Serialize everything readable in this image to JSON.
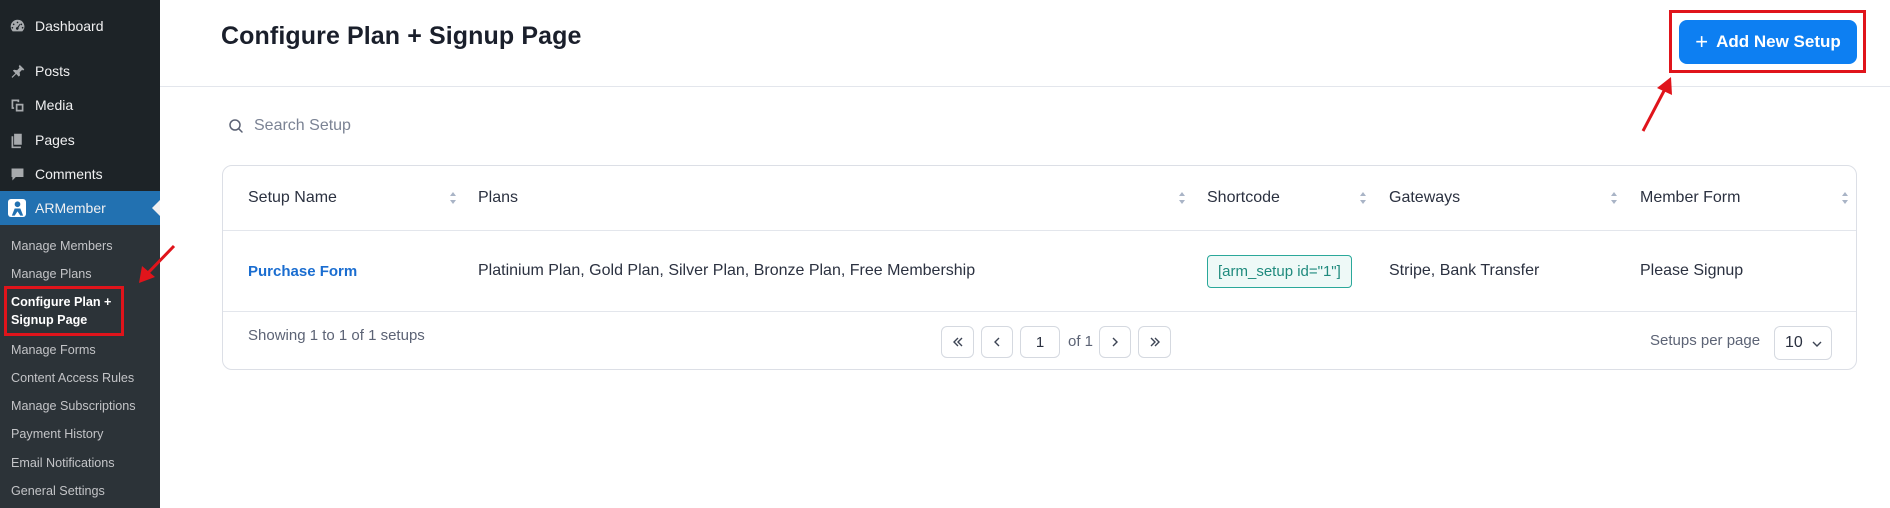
{
  "sidebar": {
    "top_items": [
      {
        "label": "Dashboard",
        "icon": "dashboard-icon"
      },
      {
        "label": "Posts",
        "icon": "pushpin-icon"
      },
      {
        "label": "Media",
        "icon": "media-icon"
      },
      {
        "label": "Pages",
        "icon": "pages-icon"
      },
      {
        "label": "Comments",
        "icon": "comment-icon"
      },
      {
        "label": "ARMember",
        "icon": "armember-logo-icon"
      }
    ],
    "sub_items": [
      "Manage Members",
      "Manage Plans",
      "Configure Plan + Signup Page",
      "Manage Forms",
      "Content Access Rules",
      "Manage Subscriptions",
      "Payment History",
      "Email Notifications",
      "General Settings"
    ],
    "current_line1": "Configure Plan +",
    "current_line2": "Signup Page"
  },
  "header": {
    "title": "Configure Plan + Signup Page",
    "add_button_label": "Add New Setup"
  },
  "search": {
    "placeholder": "Search Setup",
    "value": ""
  },
  "table": {
    "columns": [
      "Setup Name",
      "Plans",
      "Shortcode",
      "Gateways",
      "Member Form"
    ],
    "rows": [
      {
        "setup_name": "Purchase Form",
        "plans": "Platinium Plan, Gold Plan, Silver Plan, Bronze Plan, Free Membership",
        "shortcode": "[arm_setup id=\"1\"]",
        "gateways": "Stripe, Bank Transfer",
        "member_form": "Please Signup"
      }
    ]
  },
  "footer": {
    "showing": "Showing 1 to 1 of 1 setups",
    "page": "1",
    "of_label": "of 1",
    "per_page_label": "Setups per page",
    "per_page_value": "10"
  },
  "colors": {
    "accent": "#0d7ff2",
    "sidebar_bg": "#1d2327",
    "sidebar_active": "#2271b1",
    "highlight_red": "#e0141b"
  }
}
